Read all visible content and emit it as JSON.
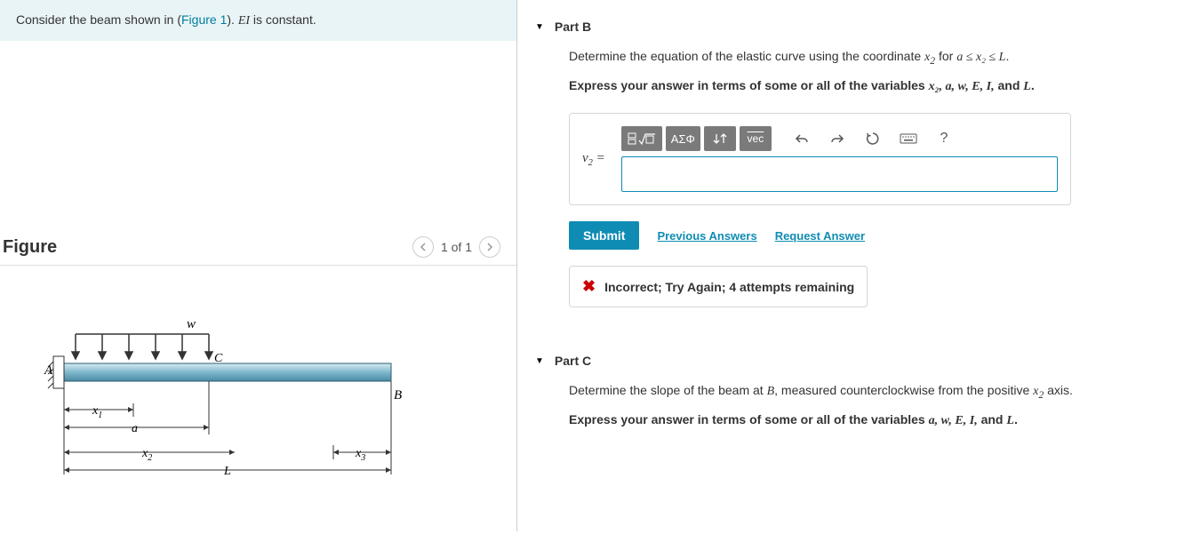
{
  "problem": {
    "prefix": "Consider the beam shown in (",
    "figure_link": "Figure 1",
    "suffix1": "). ",
    "eiconst": "EI",
    "suffix2": " is constant."
  },
  "figure_header": {
    "title": "Figure",
    "counter": "1 of 1"
  },
  "figure_labels": {
    "w": "w",
    "A": "A",
    "B": "B",
    "C": "C",
    "x1": "x",
    "x1s": "1",
    "x2": "x",
    "x2s": "2",
    "x3": "x",
    "x3s": "3",
    "a": "a",
    "L": "L"
  },
  "partB": {
    "title": "Part B",
    "instr_pre": "Determine the equation of the elastic curve using the coordinate ",
    "x2m": "x",
    "x2s": "2",
    "instr_mid": " for ",
    "range": "a ≤ x₂ ≤ L",
    "instr_end": ".",
    "express_pre": "Express your answer in terms of some or all of the variables ",
    "vars": "x₂, a, w, E, I,",
    "and": " and ",
    "lastvar": "L",
    "express_end": ".",
    "prefix_v": "v",
    "prefix_sub": "2",
    "prefix_eq": " =",
    "toolbar": {
      "templates": "",
      "greek": "ΑΣΦ",
      "subsup": "↓↑",
      "vec": "vec",
      "help": "?"
    },
    "submit": "Submit",
    "prev": "Previous Answers",
    "req": "Request Answer",
    "feedback": "Incorrect; Try Again; 4 attempts remaining"
  },
  "partC": {
    "title": "Part C",
    "instr_pre": "Determine the slope of the beam at ",
    "B": "B",
    "instr_mid": ", measured counterclockwise from the positive ",
    "x2m": "x",
    "x2s": "2",
    "instr_end": " axis.",
    "express_pre": "Express your answer in terms of some or all of the variables ",
    "vars": "a, w, E, I,",
    "and": " and ",
    "lastvar": "L",
    "express_end": "."
  }
}
